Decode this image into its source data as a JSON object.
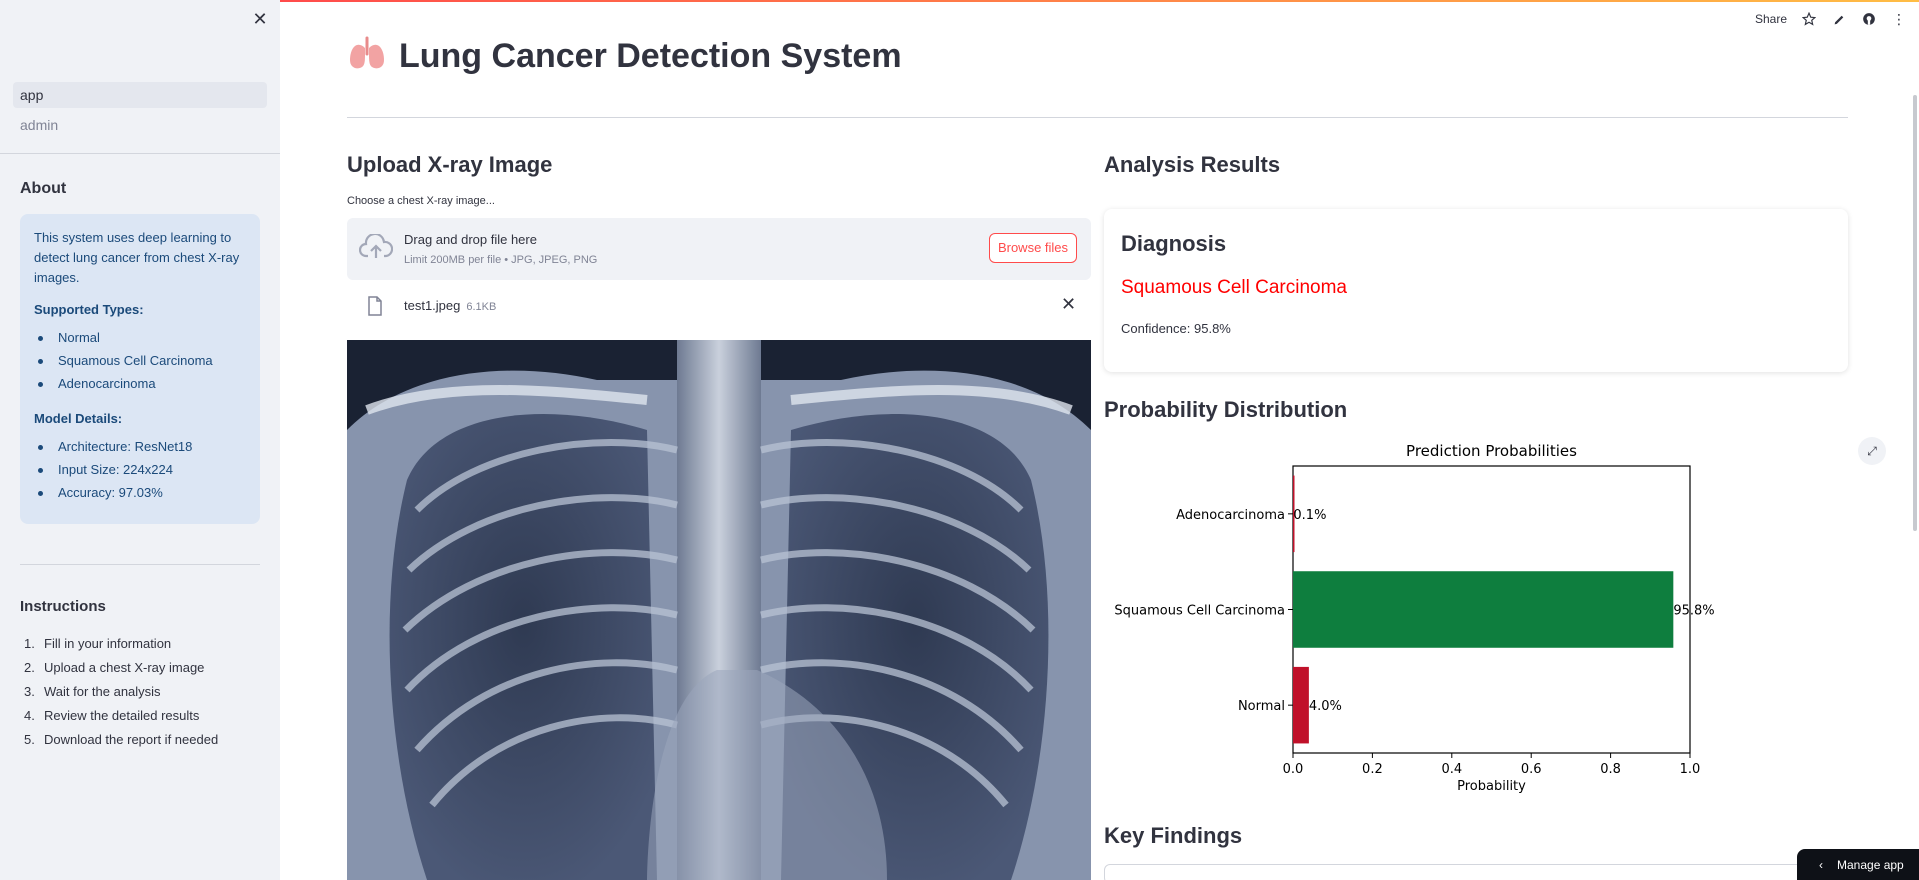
{
  "sidebar": {
    "nav": [
      {
        "label": "app",
        "active": true
      },
      {
        "label": "admin",
        "active": false
      }
    ],
    "about_title": "About",
    "about_text": "This system uses deep learning to detect lung cancer from chest X-ray images.",
    "supported_title": "Supported Types:",
    "supported_types": [
      "Normal",
      "Squamous Cell Carcinoma",
      "Adenocarcinoma"
    ],
    "model_title": "Model Details:",
    "model_details": [
      "Architecture: ResNet18",
      "Input Size: 224x224",
      "Accuracy: 97.03%"
    ],
    "instructions_title": "Instructions",
    "instructions": [
      {
        "num": "1.",
        "text": "Fill in your information"
      },
      {
        "num": "2.",
        "text": "Upload a chest X-ray image"
      },
      {
        "num": "3.",
        "text": "Wait for the analysis"
      },
      {
        "num": "4.",
        "text": "Review the detailed results"
      },
      {
        "num": "5.",
        "text": "Download the report if needed"
      }
    ]
  },
  "toolbar": {
    "share_label": "Share"
  },
  "header": {
    "title": "Lung Cancer Detection System",
    "icon": "lungs-icon"
  },
  "upload": {
    "section_title": "Upload X-ray Image",
    "label": "Choose a chest X-ray image...",
    "drop_text": "Drag and drop file here",
    "limit_text": "Limit 200MB per file • JPG, JPEG, PNG",
    "browse_label": "Browse files",
    "file_name": "test1.jpeg",
    "file_size": "6.1KB"
  },
  "results": {
    "section_title": "Analysis Results",
    "diagnosis_title": "Diagnosis",
    "diagnosis_value": "Squamous Cell Carcinoma",
    "confidence": "Confidence: 95.8%",
    "distribution_title": "Probability Distribution",
    "findings_title": "Key Findings"
  },
  "manage_app_label": "Manage app",
  "colors": {
    "accent": "#ff4b4b",
    "diagnosis": "#ff0000",
    "bar_green": "#0e7e3e",
    "bar_red": "#c0112a",
    "info_bg": "#dce6f4"
  },
  "chart_data": {
    "type": "bar",
    "orientation": "horizontal",
    "title": "Prediction Probabilities",
    "xlabel": "Probability",
    "ylabel": "",
    "categories": [
      "Adenocarcinoma",
      "Squamous Cell Carcinoma",
      "Normal"
    ],
    "values": [
      0.001,
      0.958,
      0.04
    ],
    "value_labels": [
      "0.1%",
      "95.8%",
      "4.0%"
    ],
    "colors": [
      "#c0112a",
      "#0e7e3e",
      "#c0112a"
    ],
    "xlim": [
      0,
      1.0
    ],
    "xticks": [
      "0.0",
      "0.2",
      "0.4",
      "0.6",
      "0.8",
      "1.0"
    ],
    "grid": false
  }
}
